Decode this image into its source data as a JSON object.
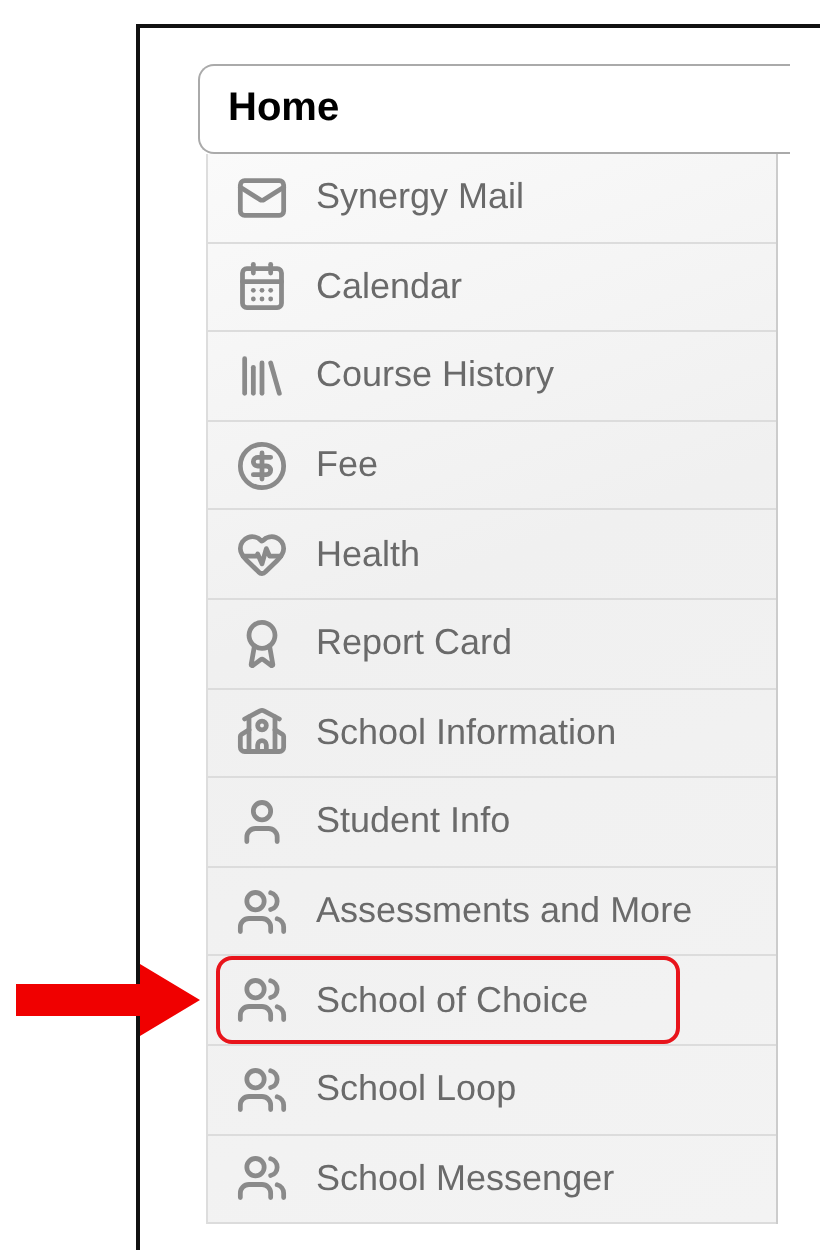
{
  "menu": {
    "title": "Home",
    "items": [
      {
        "label": "Synergy Mail",
        "kind": "mail",
        "highlighted": false
      },
      {
        "label": "Calendar",
        "kind": "calendar",
        "highlighted": false
      },
      {
        "label": "Course History",
        "kind": "books",
        "highlighted": false
      },
      {
        "label": "Fee",
        "kind": "fee",
        "highlighted": false
      },
      {
        "label": "Health",
        "kind": "health",
        "highlighted": false
      },
      {
        "label": "Report Card",
        "kind": "grade",
        "highlighted": false
      },
      {
        "label": "School Information",
        "kind": "school",
        "highlighted": false
      },
      {
        "label": "Student Info",
        "kind": "student",
        "highlighted": false
      },
      {
        "label": "Assessments and More",
        "kind": "people",
        "highlighted": false
      },
      {
        "label": "School of Choice",
        "kind": "people",
        "highlighted": true
      },
      {
        "label": "School Loop",
        "kind": "people",
        "highlighted": false
      },
      {
        "label": "School Messenger",
        "kind": "people",
        "highlighted": false
      }
    ]
  }
}
